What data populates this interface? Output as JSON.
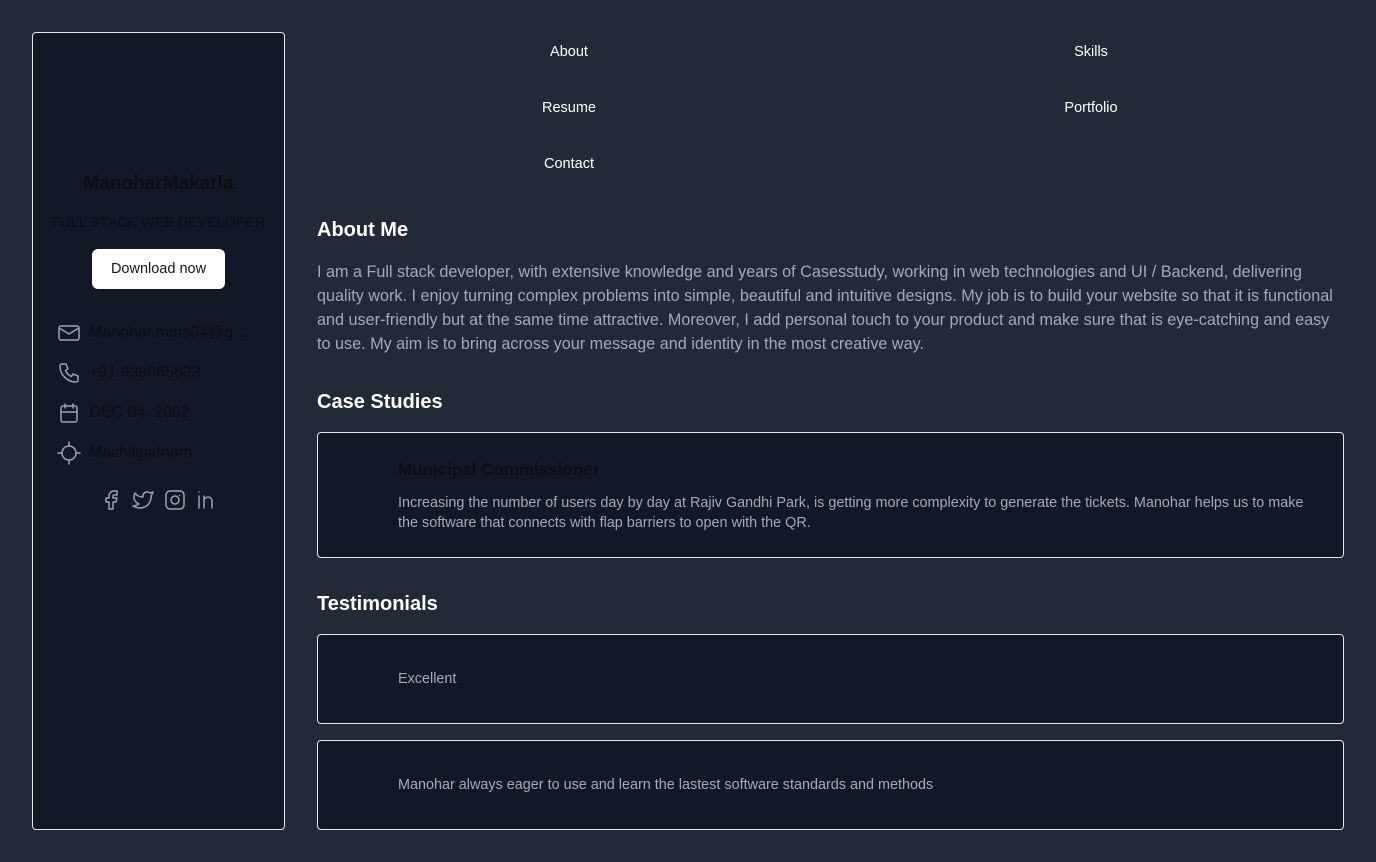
{
  "profile": {
    "name": "ManoharMakarla",
    "role": "FULL STACK WEB DEVELOPER",
    "download_label": "Download now",
    "email": "Manohar.mms04@gmail.com",
    "phone": "+91 939065833",
    "birthday": "DEC 04, 2002",
    "location": "Machilipatnam",
    "socials": [
      "facebook-icon",
      "twitter-icon",
      "instagram-icon",
      "linkedin-icon"
    ]
  },
  "nav": {
    "about": "About",
    "skills": "Skills",
    "resume": "Resume",
    "portfolio": "Portfolio",
    "contact": "Contact"
  },
  "about": {
    "title": "About Me",
    "text": "I am a Full stack developer, with extensive knowledge and years of Casesstudy, working in web technologies and UI / Backend, delivering quality work. I enjoy turning complex problems into simple, beautiful and intuitive designs. My job is to build your website so that it is functional and user-friendly but at the same time attractive. Moreover, I add personal touch to your product and make sure that is eye-catching and easy to use. My aim is to bring across your message and identity in the most creative way."
  },
  "case_studies": {
    "title": "Case Studies",
    "items": [
      {
        "title": "Municipal Commissioner",
        "description": "Increasing the number of users day by day at Rajiv Gandhi Park, is getting more complexity to generate the tickets. Manohar helps us to make the software that connects with flap barriers to open with the QR."
      }
    ]
  },
  "testimonials": {
    "title": "Testimonials",
    "items": [
      {
        "text": "Excellent"
      },
      {
        "text": "Manohar always eager to use and learn the lastest software standards and methods"
      }
    ]
  },
  "colors": {
    "page_bg": "#222a38",
    "card_bg": "#121826",
    "border": "#e5e7eb",
    "muted_text": "#a3a9b4",
    "icon": "#9ca3af"
  }
}
